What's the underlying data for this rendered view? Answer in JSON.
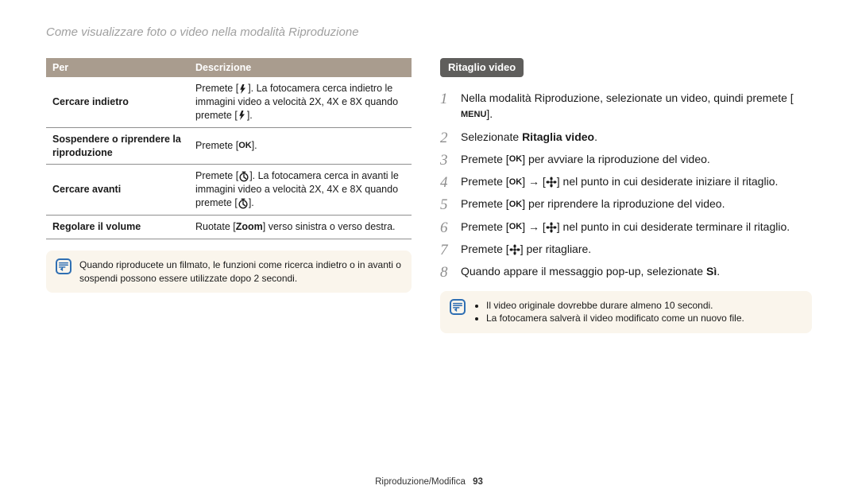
{
  "header": {
    "breadcrumb": "Come visualizzare foto o video nella modalità Riproduzione"
  },
  "table": {
    "headers": {
      "per": "Per",
      "desc": "Descrizione"
    },
    "rows": [
      {
        "per": "Cercare indietro",
        "desc_a": "Premete [",
        "desc_b": "]. La fotocamera cerca indietro le immagini video a velocità 2X, 4X e 8X quando premete [",
        "desc_c": "].",
        "icon": "flash"
      },
      {
        "per": "Sospendere o riprendere la riproduzione",
        "desc_a": "Premete [",
        "desc_b": "].",
        "icon": "ok"
      },
      {
        "per": "Cercare avanti",
        "desc_a": "Premete [",
        "desc_b": "]. La fotocamera cerca in avanti le immagini video a velocità 2X, 4X e 8X quando premete [",
        "desc_c": "].",
        "icon": "timer"
      },
      {
        "per": "Regolare il volume",
        "desc_a": "Ruotate [",
        "zoom": "Zoom",
        "desc_b": "] verso sinistra o verso destra."
      }
    ]
  },
  "note_left": "Quando riproducete un filmato, le funzioni come ricerca indietro o in avanti o sospendi possono essere utilizzate dopo 2 secondi.",
  "pill": "Ritaglio video",
  "steps": {
    "s1a": "Nella modalità Riproduzione, selezionate un video, quindi premete [",
    "s1b": "].",
    "s2a": "Selezionate ",
    "s2b": "Ritaglia video",
    "s2c": ".",
    "s3a": "Premete [",
    "s3b": "] per avviare la riproduzione del video.",
    "s4a": "Premete [",
    "s4b": "] → [",
    "s4c": "] nel punto in cui desiderate iniziare il ritaglio.",
    "s5a": "Premete [",
    "s5b": "] per riprendere la riproduzione del video.",
    "s6a": "Premete [",
    "s6b": "] → [",
    "s6c": "] nel punto in cui desiderate terminare il ritaglio.",
    "s7a": "Premete [",
    "s7b": "] per ritagliare.",
    "s8a": "Quando appare il messaggio pop-up, selezionate ",
    "s8b": "Sì",
    "s8c": "."
  },
  "note_right": {
    "b1": "Il video originale dovrebbe durare almeno 10 secondi.",
    "b2": "La fotocamera salverà il video modificato come un nuovo file."
  },
  "icons": {
    "ok": "OK",
    "menu": "MENU"
  },
  "footer": {
    "section": "Riproduzione/Modifica",
    "page": "93"
  }
}
